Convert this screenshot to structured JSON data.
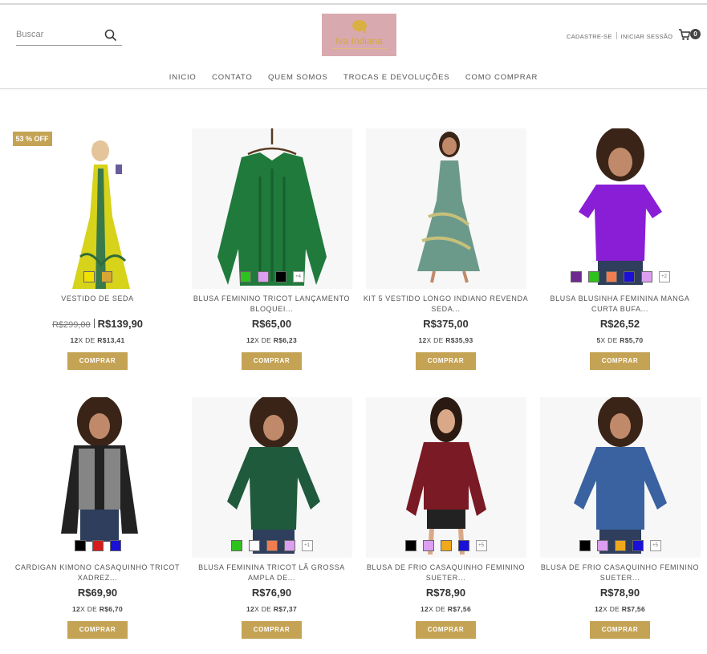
{
  "header": {
    "search_placeholder": "Buscar",
    "logo_text": "Iva Indiana",
    "register": "CADASTRE-SE",
    "login": "INICIAR SESSÃO",
    "cart_count": "0"
  },
  "nav": [
    "INICIO",
    "CONTATO",
    "QUEM SOMOS",
    "TROCAS E DEVOLUÇÕES",
    "COMO COMPRAR"
  ],
  "products": [
    {
      "name": "VESTIDO DE SEDA",
      "badge": "53 % OFF",
      "old_price": "R$299,00",
      "price": "R$139,90",
      "inst_n": "12",
      "inst_x": "X DE ",
      "inst_value": "R$13,41",
      "button": "COMPRAR",
      "swatches": [
        "#f2e100",
        "#d7a634"
      ],
      "more": ""
    },
    {
      "name": "BLUSA FEMININO TRICOT LANÇAMENTO BLOQUEI...",
      "price": "R$65,00",
      "inst_n": "12",
      "inst_x": "X DE ",
      "inst_value": "R$6,23",
      "button": "COMPRAR",
      "swatches": [
        "#2ec21c",
        "#dc9ef0",
        "#000000"
      ],
      "more": "+4"
    },
    {
      "name": "KIT 5 VESTIDO LONGO INDIANO REVENDA SEDA...",
      "price": "R$375,00",
      "inst_n": "12",
      "inst_x": "X DE ",
      "inst_value": "R$35,93",
      "button": "COMPRAR",
      "swatches": [],
      "more": ""
    },
    {
      "name": "BLUSA BLUSINHA FEMININA MANGA CURTA BUFA...",
      "price": "R$26,52",
      "inst_n": "5",
      "inst_x": "X DE ",
      "inst_value": "R$5,70",
      "button": "COMPRAR",
      "swatches": [
        "#6e2a8f",
        "#2ec21c",
        "#f07d4f",
        "#1a10d8",
        "#dc9ef0"
      ],
      "more": "+2"
    },
    {
      "name": "CARDIGAN KIMONO CASAQUINHO TRICOT XADREZ...",
      "price": "R$69,90",
      "inst_n": "12",
      "inst_x": "X DE ",
      "inst_value": "R$6,70",
      "button": "COMPRAR",
      "swatches": [
        "#000000",
        "#d81c1c",
        "#1a10d8"
      ],
      "more": ""
    },
    {
      "name": "BLUSA FEMININA TRICOT LÃ GROSSA AMPLA DE...",
      "price": "R$76,90",
      "inst_n": "12",
      "inst_x": "X DE ",
      "inst_value": "R$7,37",
      "button": "COMPRAR",
      "swatches": [
        "#2ec21c",
        "#ffffff",
        "#f07d4f",
        "#dc9ef0"
      ],
      "more": "+1"
    },
    {
      "name": "BLUSA DE FRIO CASAQUINHO FEMININO SUETER...",
      "price": "R$78,90",
      "inst_n": "12",
      "inst_x": "X DE ",
      "inst_value": "R$7,56",
      "button": "COMPRAR",
      "swatches": [
        "#000000",
        "#dc9ef0",
        "#f0a81c",
        "#1a10d8"
      ],
      "more": "+5"
    },
    {
      "name": "BLUSA DE FRIO CASAQUINHO FEMININO SUETER...",
      "price": "R$78,90",
      "inst_n": "12",
      "inst_x": "X DE ",
      "inst_value": "R$7,56",
      "button": "COMPRAR",
      "swatches": [
        "#000000",
        "#dc9ef0",
        "#f0a81c",
        "#1a10d8"
      ],
      "more": "+5"
    }
  ],
  "colors": {
    "accent": "#c5a355",
    "logo_bg": "#d9a9b0"
  }
}
